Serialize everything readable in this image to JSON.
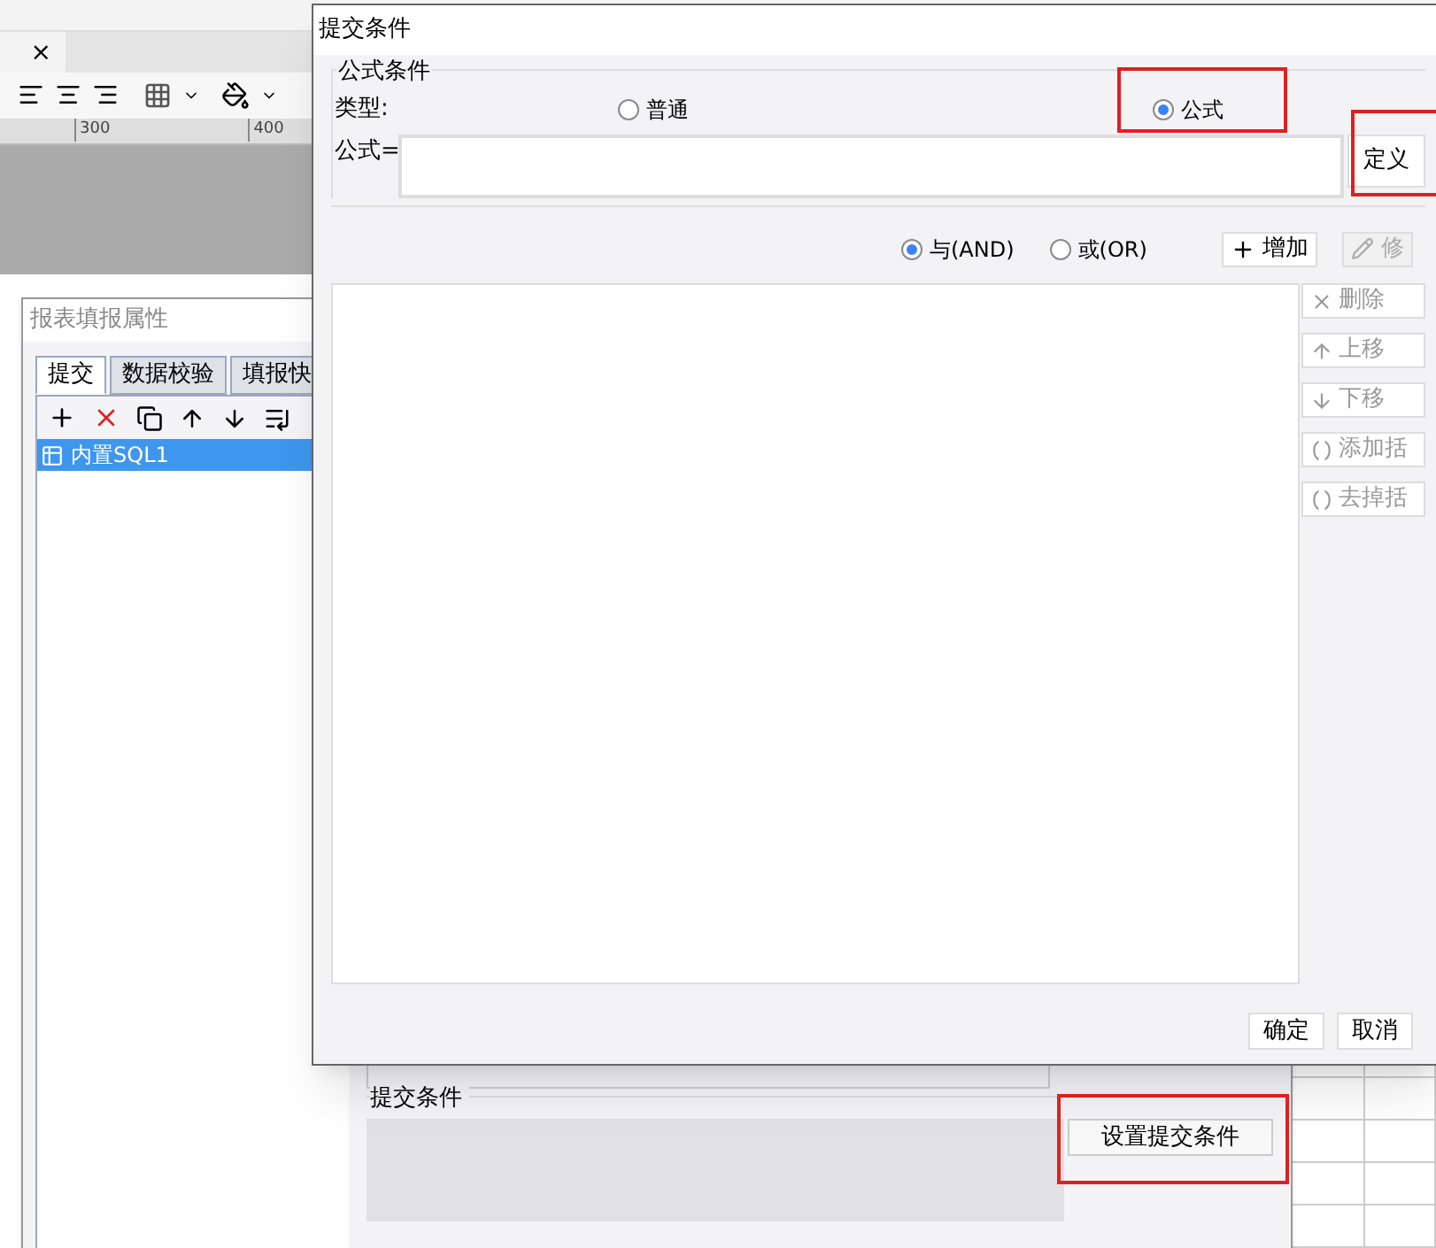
{
  "app": {
    "tab_close": "×",
    "ruler_marks": [
      "300",
      "400"
    ]
  },
  "properties_panel": {
    "title": "报表填报属性",
    "tabs": [
      {
        "label": "提交",
        "selected": true
      },
      {
        "label": "数据校验",
        "selected": false
      },
      {
        "label": "填报快",
        "selected": false
      }
    ],
    "items": [
      {
        "label": "内置SQL1",
        "selected": true
      }
    ],
    "submit_group": {
      "title": "提交条件",
      "button": "设置提交条件"
    }
  },
  "dialog": {
    "title": "提交条件",
    "group_title": "公式条件",
    "type_label": "类型:",
    "type_options": [
      {
        "label": "普通",
        "selected": false
      },
      {
        "label": "公式",
        "selected": true
      }
    ],
    "formula_label": "公式=",
    "define_button": "定义",
    "logic_options": [
      {
        "label": "与(AND)",
        "selected": true
      },
      {
        "label": "或(OR)",
        "selected": false
      }
    ],
    "add_button": "增加",
    "edit_button": {
      "label": "修",
      "disabled": true
    },
    "side_buttons": [
      {
        "kind": "delete",
        "label": "删除",
        "disabled": true
      },
      {
        "kind": "up",
        "label": "上移",
        "disabled": true
      },
      {
        "kind": "down",
        "label": "下移",
        "disabled": true
      },
      {
        "kind": "add_brackets",
        "label": "添加括",
        "disabled": true
      },
      {
        "kind": "remove_brackets",
        "label": "去掉括",
        "disabled": true
      }
    ],
    "buttons": [
      "确定",
      "取消"
    ]
  }
}
